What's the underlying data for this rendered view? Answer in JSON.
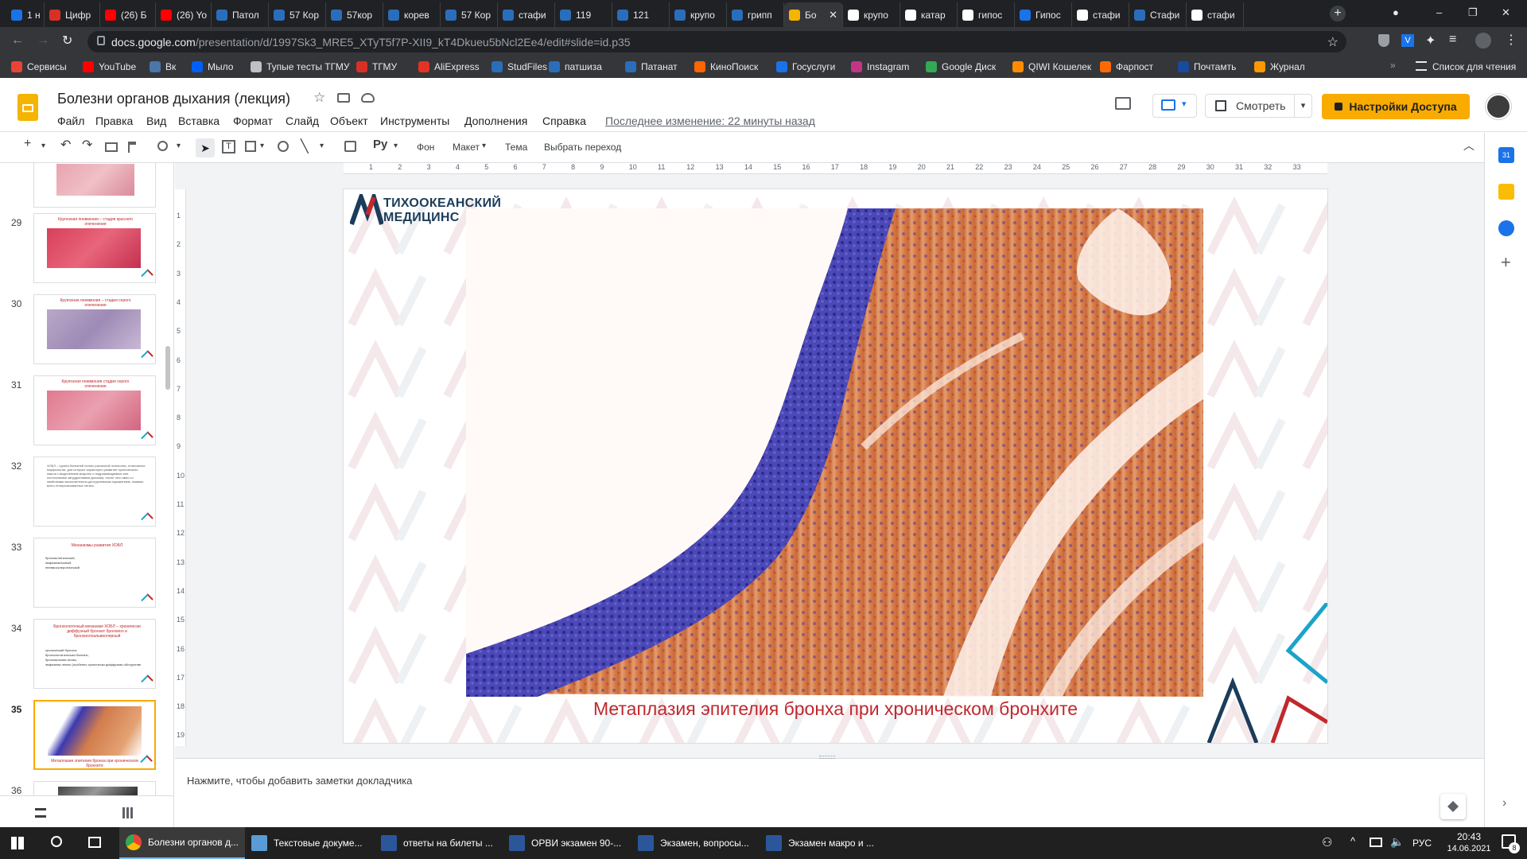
{
  "browser": {
    "tabs": [
      {
        "label": "1 н",
        "color": "#1a73e8"
      },
      {
        "label": "Цифр",
        "color": "#d93025"
      },
      {
        "label": "(26) Б",
        "color": "#ff0000"
      },
      {
        "label": "(26) Yo",
        "color": "#ff0000"
      },
      {
        "label": "Патол",
        "color": "#2a6ebb"
      },
      {
        "label": "57 Кор",
        "color": "#2a6ebb"
      },
      {
        "label": "57кор",
        "color": "#2a6ebb"
      },
      {
        "label": "корев",
        "color": "#2a6ebb"
      },
      {
        "label": "57 Кор",
        "color": "#2a6ebb"
      },
      {
        "label": "стафи",
        "color": "#2a6ebb"
      },
      {
        "label": "119",
        "color": "#2a6ebb"
      },
      {
        "label": "121",
        "color": "#2a6ebb"
      },
      {
        "label": "крупо",
        "color": "#2a6ebb"
      },
      {
        "label": "грипп",
        "color": "#2a6ebb"
      },
      {
        "label": "Бо",
        "color": "#f4b400"
      },
      {
        "label": "крупо",
        "color": "#ffffff"
      },
      {
        "label": "катар",
        "color": "#ffffff"
      },
      {
        "label": "гипос",
        "color": "#ffffff"
      },
      {
        "label": "Гипос",
        "color": "#1a73e8"
      },
      {
        "label": "стафи",
        "color": "#ffffff"
      },
      {
        "label": "Стафи",
        "color": "#2a6ebb"
      },
      {
        "label": "стафи",
        "color": "#ffffff"
      }
    ],
    "active_tab_index": 14,
    "url_domain": "docs.google.com",
    "url_path": "/presentation/d/1997Sk3_MRE5_XTyT5f7P-XII9_kT4Dkueu5bNcl2Ee4/edit#slide=id.p35",
    "bookmarks": [
      {
        "label": "Сервисы",
        "color": "#ea4335"
      },
      {
        "label": "YouTube",
        "color": "#ff0000"
      },
      {
        "label": "Вк",
        "color": "#4a76a8"
      },
      {
        "label": "Мыло",
        "color": "#005ff9"
      },
      {
        "label": "Тупые тесты ТГМУ",
        "color": "#bdc1c6"
      },
      {
        "label": "ТГМУ",
        "color": "#d93025"
      },
      {
        "label": "AliExpress",
        "color": "#e43225"
      },
      {
        "label": "StudFiles",
        "color": "#2a6ebb"
      },
      {
        "label": "патшиза",
        "color": "#2a6ebb"
      },
      {
        "label": "Патанат",
        "color": "#2a6ebb"
      },
      {
        "label": "КиноПоиск",
        "color": "#ff6600"
      },
      {
        "label": "Госуслуги",
        "color": "#1a73e8"
      },
      {
        "label": "Instagram",
        "color": "#c13584"
      },
      {
        "label": "Google Диск",
        "color": "#34a853"
      },
      {
        "label": "QIWI Кошелек",
        "color": "#ff8c00"
      },
      {
        "label": "Фарпост",
        "color": "#ff6a00"
      },
      {
        "label": "Почтамть",
        "color": "#1a4a9c"
      },
      {
        "label": "Журнал",
        "color": "#ff9800"
      }
    ],
    "reading_list": "Список для чтения"
  },
  "docs": {
    "title": "Болезни органов дыхания (лекция)",
    "menu": [
      "Файл",
      "Правка",
      "Вид",
      "Вставка",
      "Формат",
      "Слайд",
      "Объект",
      "Инструменты",
      "Дополнения",
      "Справка"
    ],
    "last_edit": "Последнее изменение: 22 минуты назад",
    "present_label": "Смотреть",
    "share_label": "Настройки Доступа",
    "toolbar": {
      "background": "Фон",
      "layout": "Макет",
      "theme": "Тема",
      "transition": "Выбрать переход"
    }
  },
  "filmstrip": {
    "slides": [
      {
        "num": "29",
        "title": "Крупозная пневмония – стадия красного опеченения",
        "type": "image-red"
      },
      {
        "num": "30",
        "title": "Крупозная пневмония – стадия серого опеченения",
        "type": "image-purple"
      },
      {
        "num": "31",
        "title": "Крупозная пневмония стадия серого опеченения",
        "type": "image-pink"
      },
      {
        "num": "32",
        "title": "ХОБЛ – группа болезней легких различной этиологии, отличаются морфологии, для которых характерно развитие хронического кашля с выделением мокроты и подрывающимися или постоянными затруднениями дыхания, после чего явно со свойствами воспалительно-деструктивным поражением, помимо всего генерализованных легких.",
        "type": "text"
      },
      {
        "num": "33",
        "title": "Механизмы развития ХОБЛ",
        "bullets": [
          "бронхиолитический,",
          "эмфизематозный",
          "пневмосклеротический"
        ],
        "type": "bullets"
      },
      {
        "num": "34",
        "title": "Бронхолегочный механизм ХОБЛ – хронически диффузный бронхит бронхиол и бронхиолоальвеолярный",
        "bullets": [
          "хронический бронхит,",
          "бронхоэктатическая болезнь,",
          "бронхиальная астма,",
          "эмфизема легких (особенно хронически диффузная обструктивная)."
        ],
        "type": "bullets"
      },
      {
        "num": "35",
        "title": "Метаплазия эпителия бронха при хроническом бронхите",
        "type": "image-selected"
      },
      {
        "num": "36",
        "title": "",
        "type": "image-gray"
      }
    ]
  },
  "slide": {
    "logo_line1": "ТИХООКЕАНСКИЙ",
    "logo_line2": "МЕДИЦИНС",
    "caption": "Метаплазия эпителия бронха при хроническом бронхите",
    "caption_color": "#c0282d"
  },
  "ruler": {
    "h_labels": [
      "1",
      "2",
      "3",
      "4",
      "5",
      "6",
      "7",
      "8",
      "9",
      "10",
      "11",
      "12",
      "13",
      "14",
      "15",
      "16",
      "17",
      "18",
      "19",
      "20",
      "21",
      "22",
      "23",
      "24",
      "25",
      "26",
      "27",
      "28",
      "29",
      "30",
      "31",
      "32",
      "33"
    ],
    "v_labels": [
      "1",
      "2",
      "3",
      "4",
      "5",
      "6",
      "7",
      "8",
      "9",
      "10",
      "11",
      "12",
      "13",
      "14",
      "15",
      "16",
      "17",
      "18",
      "19"
    ]
  },
  "notes": {
    "placeholder": "Нажмите, чтобы добавить заметки докладчика"
  },
  "taskbar": {
    "items": [
      {
        "label": "Болезни органов д...",
        "icon": "chrome-icon"
      },
      {
        "label": "Текстовые докуме...",
        "icon": "file-explorer-icon"
      },
      {
        "label": "ответы на билеты ...",
        "icon": "word-icon"
      },
      {
        "label": "ОРВИ экзамен 90-...",
        "icon": "word-icon"
      },
      {
        "label": "Экзамен, вопросы...",
        "icon": "word-icon"
      },
      {
        "label": "Экзамен макро и ...",
        "icon": "word-icon"
      }
    ],
    "lang": "РУС",
    "time": "20:43",
    "date": "14.06.2021",
    "notifications": "8"
  }
}
